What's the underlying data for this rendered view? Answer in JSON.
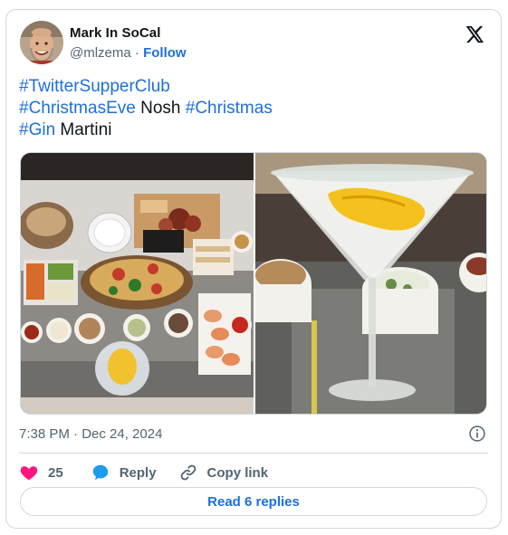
{
  "author": {
    "name": "Mark In SoCal",
    "handle": "@mlzema",
    "separator": "·",
    "follow_label": "Follow"
  },
  "tweet": {
    "lines": [
      [
        {
          "text": "#TwitterSupperClub",
          "hashtag": true
        }
      ],
      [
        {
          "text": "#ChristmasEve",
          "hashtag": true
        },
        {
          "text": " Nosh",
          "hashtag": false
        },
        {
          "text": " ",
          "hashtag": false
        },
        {
          "text": "#Christmas",
          "hashtag": true
        }
      ],
      [
        {
          "text": "#Gin",
          "hashtag": true
        },
        {
          "text": " Martini",
          "hashtag": false
        }
      ]
    ],
    "timestamp": "7:38 PM · Dec 24, 2024"
  },
  "actions": {
    "like_count": "25",
    "reply_label": "Reply",
    "copy_link_label": "Copy link",
    "read_replies_label": "Read 6 replies"
  },
  "colors": {
    "link": "#1d6fd8",
    "heart": "#f91880",
    "muted": "#536471",
    "border": "#cfd9de"
  },
  "icons": [
    "x-logo-icon",
    "info-icon",
    "heart-icon",
    "reply-bubble-icon",
    "link-icon"
  ]
}
